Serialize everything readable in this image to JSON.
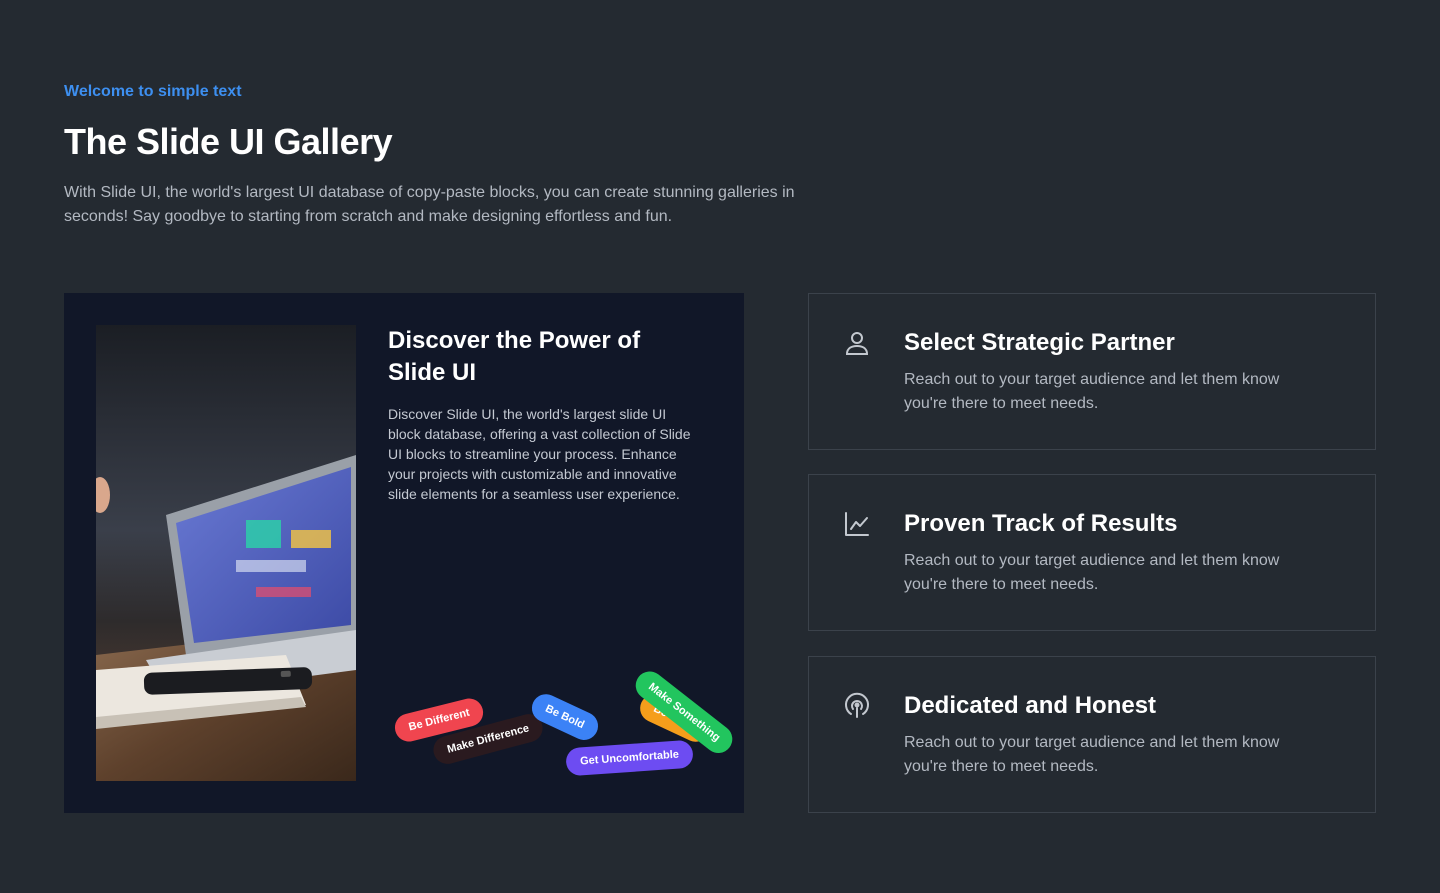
{
  "header": {
    "eyebrow": "Welcome to simple text",
    "title": "The Slide UI Gallery",
    "description": "With Slide UI, the world's largest UI database of copy-paste blocks, you can create stunning galleries in seconds! Say goodbye to starting from scratch and make designing effortless and fun."
  },
  "feature": {
    "title": "Discover the Power of Slide UI",
    "text": "Discover Slide UI, the world's largest slide UI block database, offering a vast collection of Slide UI blocks to streamline your process. Enhance your projects with customizable and innovative slide elements for a seamless user experience.",
    "tags": [
      {
        "label": "Be Different",
        "color": "#f0454f"
      },
      {
        "label": "Make Difference",
        "color": "#2a1a1f"
      },
      {
        "label": "Be Bold",
        "color": "#3b82f6"
      },
      {
        "label": "Get Uncomfortable",
        "color": "#6d4cf2"
      },
      {
        "label": "Be Good",
        "color": "#f59e1b"
      },
      {
        "label": "Make Something",
        "color": "#22c55e"
      }
    ]
  },
  "cards": [
    {
      "icon": "user-icon",
      "title": "Select Strategic Partner",
      "text": "Reach out to your target audience and let them know you're there to meet needs."
    },
    {
      "icon": "chart-line-icon",
      "title": "Proven Track of Results",
      "text": "Reach out to your target audience and let them know you're there to meet needs."
    },
    {
      "icon": "podcast-icon",
      "title": "Dedicated and Honest",
      "text": "Reach out to your target audience and let them know you're there to meet needs."
    }
  ],
  "colors": {
    "background": "#242a31",
    "accent": "#3d8ff0",
    "feature_background": "#111728",
    "card_border": "#3b424b"
  }
}
